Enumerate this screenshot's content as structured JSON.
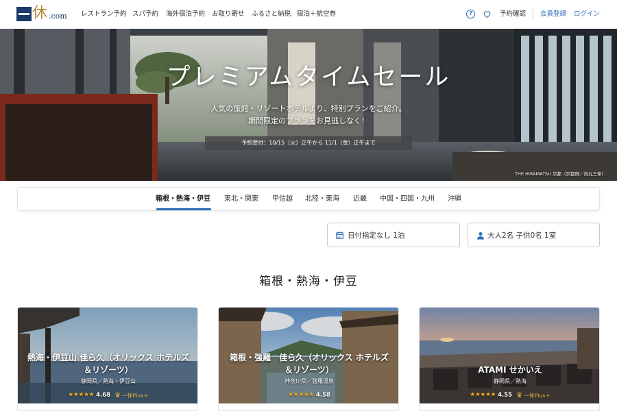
{
  "header": {
    "logo_kanji": "休",
    "logo_com": ".com",
    "nav": [
      "レストラン予約",
      "スパ予約",
      "海外宿泊予約",
      "お取り寄せ",
      "ふるさと納税",
      "宿泊＋航空券"
    ],
    "reservation_confirm": "予約確認",
    "member_register": "会員登録",
    "login": "ログイン",
    "accent_color": "#2e6db4"
  },
  "hero": {
    "title": "プレミアムタイムセール",
    "subtitle_line1": "人気の旅館・リゾートホテルより、特別プランをご紹介。",
    "subtitle_line2": "期間限定のプランをお見逃しなく！",
    "period": "予約受付：10/15（火）正午から 11/1（金）正午まで",
    "caption": "THE HIRAMATSU 京都（京都府／烏丸三条）"
  },
  "regions": {
    "tabs": [
      "箱根・熱海・伊豆",
      "東北・関東",
      "甲信越",
      "北陸・東海",
      "近畿",
      "中国・四国・九州",
      "沖縄"
    ],
    "active_index": 0
  },
  "search": {
    "date": "日付指定なし 1泊",
    "guests": "大人2名 子供0名 1室",
    "date_icon": "calendar-icon",
    "guests_icon": "person-icon"
  },
  "section_title": "箱根・熱海・伊豆",
  "hotels": [
    {
      "name_line1": "熱海・伊豆山 佳ら久（オリックス ホテルズ",
      "name_line2": "＆リゾーツ）",
      "area": "静岡県／熱海・伊豆山",
      "stars": "★★★★★",
      "score": "4.68",
      "plus": "一休Plus＋"
    },
    {
      "name_line1": "箱根・強羅　佳ら久（オリックス ホテルズ",
      "name_line2": "＆リゾーツ）",
      "area": "神奈川県／強羅温泉",
      "stars": "★★★★★",
      "score": "4.58",
      "plus": ""
    },
    {
      "name_line1": "ATAMI せかいえ",
      "name_line2": "",
      "area": "静岡県／熱海",
      "stars": "★★★★★",
      "score": "4.55",
      "plus": "一休Plus＋"
    }
  ]
}
